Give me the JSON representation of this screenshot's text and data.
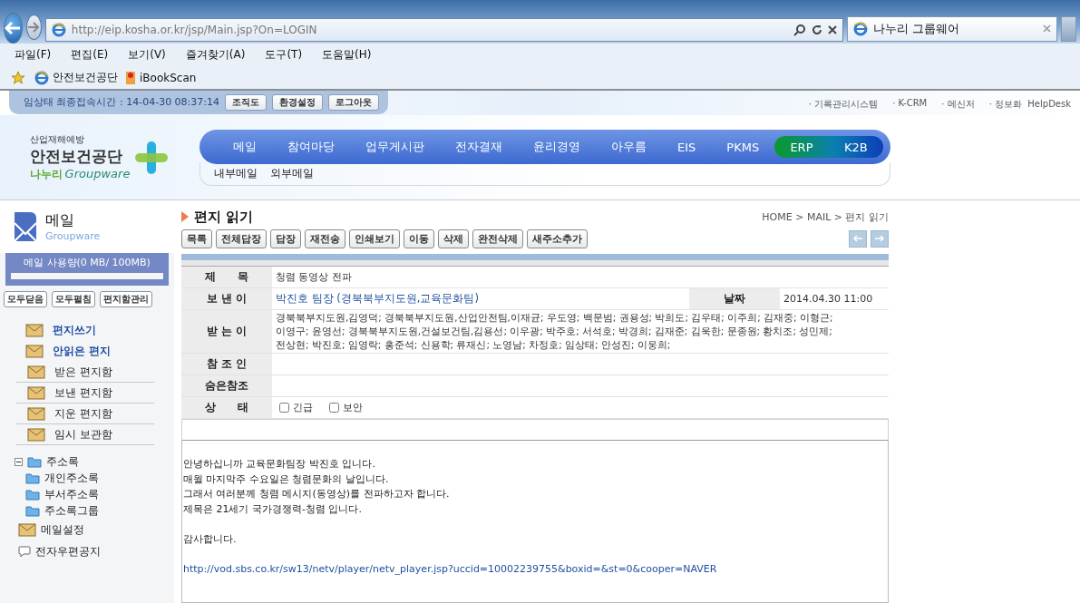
{
  "browser": {
    "url": "http://eip.kosha.or.kr/jsp/Main.jsp?On=LOGIN",
    "tab_title": "나누리 그룹웨어",
    "menu": [
      "파일(F)",
      "편집(E)",
      "보기(V)",
      "즐겨찾기(A)",
      "도구(T)",
      "도움말(H)"
    ],
    "favorites": [
      "안전보건공단",
      "iBookScan"
    ]
  },
  "userbar": {
    "info": "임상태 최종접속시간 : 14-04-30 08:37:14",
    "buttons": [
      "조직도",
      "환경설정",
      "로그아웃"
    ]
  },
  "top_links": [
    "· 기록관리시스템",
    "· K-CRM",
    "· 메신저",
    "· 정보화  HelpDesk"
  ],
  "logo": {
    "tagline": "산업재해예방",
    "name": "안전보건공단",
    "sub_korean": "나누리",
    "sub_latin": "Groupware"
  },
  "nav": {
    "items": [
      "메일",
      "참여마당",
      "업무게시판",
      "전자결재",
      "윤리경영",
      "아우름",
      "EIS",
      "PKMS"
    ],
    "systems": [
      "ERP",
      "K2B"
    ],
    "submenu": [
      "내부메일",
      "외부메일"
    ]
  },
  "sidebar": {
    "title": "메일",
    "subtitle": "Groupware",
    "usage": {
      "label": "메일 사용량(0 MB/ 100MB)",
      "level": 0
    },
    "tools": [
      "모두닫음",
      "모두펼침",
      "편지함관리"
    ],
    "items": [
      {
        "label": "편지쓰기",
        "kind": "primary"
      },
      {
        "label": "안읽은 편지",
        "kind": "primary"
      },
      {
        "label": "받은 편지함",
        "kind": "folder"
      },
      {
        "label": "보낸 편지함",
        "kind": "folder"
      },
      {
        "label": "지운 편지함",
        "kind": "folder"
      },
      {
        "label": "임시 보관함",
        "kind": "folder"
      }
    ],
    "tree": {
      "label": "주소록",
      "expanded": true,
      "children": [
        {
          "label": "개인주소록"
        },
        {
          "label": "부서주소록"
        },
        {
          "label": "주소록그룹"
        }
      ]
    },
    "extras": [
      "메일설정",
      "전자우편공지"
    ]
  },
  "content": {
    "title": "편지 읽기",
    "breadcrumb": "HOME > MAIL > 편지 읽기",
    "actions": [
      "목록",
      "전체답장",
      "답장",
      "재전송",
      "인쇄보기",
      "이동",
      "삭제",
      "완전삭제",
      "새주소추가"
    ],
    "fields": {
      "subject_label": "제　　목",
      "subject": "청렴 동영상 전파",
      "sender_label": "보 낸 이",
      "sender": "박진호 팀장 (경북북부지도원,교육문화팀)",
      "date_label": "날짜",
      "date": "2014.04.30 11:00",
      "recipients_label": "받 는 이",
      "recipients": [
        "경북북부지도원,김영덕; 경북북부지도원,산업안전팀,이재균; 우도영; 백문범; 권용성; 박희도; 김우태; 이주희; 김재중; 이형근;",
        "이영구; 윤영선; 경북북부지도원,건설보건팀,김용선; 이우광; 박주호; 서석호; 박경희; 김재준; 김욱한; 문종원; 황치조; 성민제;",
        "전상현; 박진호; 임영락; 홍준석; 신용학; 류재신; 노영남; 차정호; 임상태; 안성진; 이웅희;"
      ],
      "cc_label": "참 조 인",
      "bcc_label": "숨은참조",
      "status_label": "상　　태",
      "status": [
        {
          "label": "긴급",
          "checked": false
        },
        {
          "label": "보안",
          "checked": false
        }
      ]
    },
    "body": [
      [
        "안녕하십니까  교육문화팀장 박진호 입니다.",
        "매월 마지막주 수요일은 청렴문화의 날입니다.",
        "그래서 여러분께 청렴 메시지(동영상)를 전파하고자 합니다.",
        "제목은 21세기 국가경쟁력-청렴 입니다."
      ],
      [
        "감사합니다."
      ]
    ],
    "link": "http://vod.sbs.co.kr/sw13/netv/player/netv_player.jsp?uccid=10002239755&boxid=&st=0&cooper=NAVER"
  }
}
